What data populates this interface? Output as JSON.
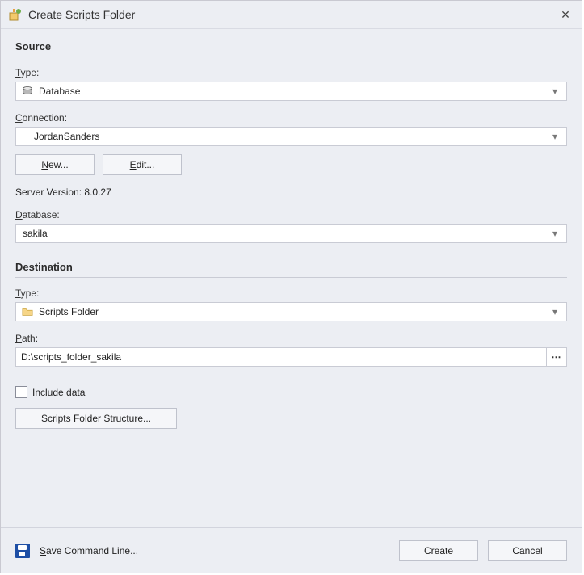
{
  "window": {
    "title": "Create Scripts Folder"
  },
  "source": {
    "heading": "Source",
    "type_label": "Type:",
    "type_value": "Database",
    "connection_label": "Connection:",
    "connection_value": "JordanSanders",
    "new_btn": "New...",
    "edit_btn": "Edit...",
    "server_version_label": "Server Version:",
    "server_version_value": "8.0.27",
    "database_label": "Database:",
    "database_value": "sakila"
  },
  "destination": {
    "heading": "Destination",
    "type_label": "Type:",
    "type_value": "Scripts Folder",
    "path_label": "Path:",
    "path_value": "D:\\scripts_folder_sakila",
    "include_data_label": "Include data",
    "structure_btn": "Scripts Folder Structure..."
  },
  "footer": {
    "save_cmd": "Save Command Line...",
    "create": "Create",
    "cancel": "Cancel"
  }
}
